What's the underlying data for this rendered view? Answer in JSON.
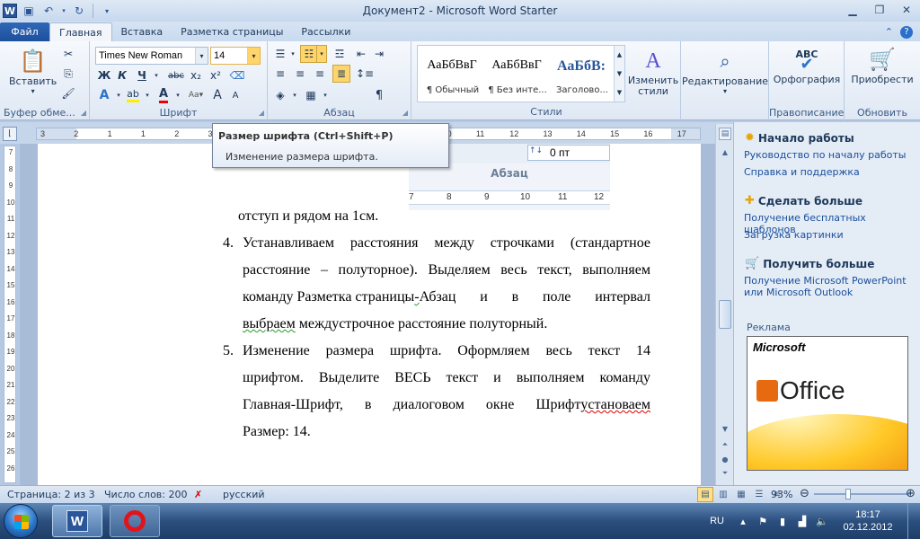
{
  "window": {
    "title": "Документ2 - Microsoft Word Starter",
    "app_icon_letter": "W"
  },
  "tabs": {
    "file": "Файл",
    "items": [
      "Главная",
      "Вставка",
      "Разметка страницы",
      "Рассылки"
    ]
  },
  "ribbon": {
    "clipboard": {
      "paste": "Вставить",
      "label": "Буфер обме..."
    },
    "font": {
      "name_value": "Times New Roman",
      "size_value": "14",
      "bold": "Ж",
      "italic": "К",
      "underline": "Ч",
      "strike": "abc",
      "subscript": "x₂",
      "superscript": "x²",
      "grow": "A",
      "shrink": "A",
      "label": "Шрифт"
    },
    "paragraph": {
      "label": "Абзац",
      "pilcrow": "¶"
    },
    "styles": {
      "items": [
        {
          "sample": "АаБбВвГ",
          "name": "¶ Обычный"
        },
        {
          "sample": "АаБбВвГ",
          "name": "¶ Без инте..."
        },
        {
          "sample": "АаБбВ:",
          "name": "Заголово..."
        }
      ],
      "change": "Изменить стили",
      "label": "Стили"
    },
    "editing": {
      "label": "Редактирование"
    },
    "proofing": {
      "spelling": "Орфография",
      "label": "Правописание",
      "abc": "ABC"
    },
    "upgrade": {
      "button": "Приобрести",
      "label": "Обновить"
    }
  },
  "tooltip": {
    "title": "Размер шрифта (Ctrl+Shift+P)",
    "description": "Изменение размера шрифта."
  },
  "ruler": {
    "ticks": [
      "3",
      "2",
      "1",
      "1",
      "2",
      "3",
      "4",
      "5",
      "6",
      "7",
      "8",
      "9",
      "10",
      "11",
      "12",
      "13",
      "14",
      "15",
      "16",
      "17"
    ],
    "vticks": [
      "7",
      "8",
      "9",
      "10",
      "11",
      "12",
      "13",
      "14",
      "15",
      "16",
      "17",
      "18",
      "19",
      "20",
      "21",
      "22",
      "23",
      "24",
      "25",
      "26"
    ]
  },
  "picture": {
    "spacing_value": "0 пт",
    "group_label": "Абзац",
    "ruler_ticks": [
      "7",
      "8",
      "9",
      "10",
      "11",
      "12"
    ]
  },
  "document": {
    "line0": "отступ и рядом на 1см.",
    "item4": {
      "num": "4.",
      "l1": "Устанавливаем расстояния между строчками (стандартное",
      "l2": "расстояние – полуторное). Выделяем весь текст, выполняем",
      "l3a": "команду Разметка страницы",
      "l3b": "-",
      "l3c": " Абзац и в поле интервал",
      "l4a": "выбраем",
      "l4b": " междустрочное расстояние полуторный."
    },
    "item5": {
      "num": "5.",
      "l1": "Изменение размера шрифта. Оформляем весь текст 14",
      "l2": "шрифтом. Выделите ВЕСЬ текст и выполняем команду",
      "l3a": "Главная-Шрифт, в диалоговом окне Шрифт ",
      "l3b": "установаем",
      "l4": "Размер: 14."
    }
  },
  "pane": {
    "start": {
      "title": "Начало работы",
      "links": [
        "Руководство по началу работы",
        "Справка и поддержка"
      ]
    },
    "more": {
      "title": "Сделать больше",
      "links": [
        "Получение бесплатных шаблонов",
        "Загрузка картинки"
      ]
    },
    "get_more": {
      "title": "Получить больше",
      "link": "Получение Microsoft PowerPoint или Microsoft Outlook"
    },
    "ad_label": "Реклама",
    "ad": {
      "brand": "Microsoft",
      "product": "Office"
    }
  },
  "statusbar": {
    "page": "Страница: 2 из 3",
    "words": "Число слов: 200",
    "language": "русский",
    "zoom": "93%",
    "zoom_fraction": 0.36
  },
  "taskbar": {
    "lang": "RU",
    "time": "18:17",
    "date": "02.12.2012"
  }
}
